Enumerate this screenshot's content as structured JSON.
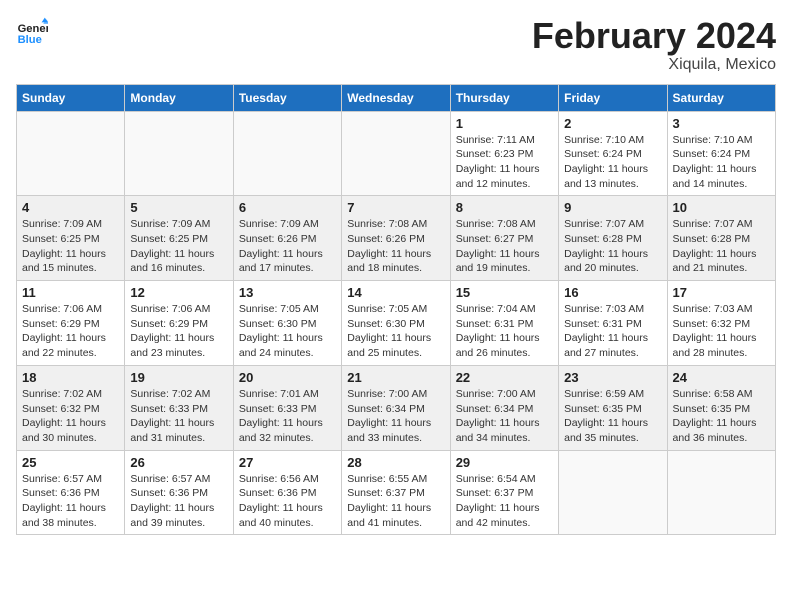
{
  "header": {
    "logo_line1": "General",
    "logo_line2": "Blue",
    "month": "February 2024",
    "location": "Xiquila, Mexico"
  },
  "weekdays": [
    "Sunday",
    "Monday",
    "Tuesday",
    "Wednesday",
    "Thursday",
    "Friday",
    "Saturday"
  ],
  "weeks": [
    [
      {
        "day": "",
        "info": "",
        "empty": true
      },
      {
        "day": "",
        "info": "",
        "empty": true
      },
      {
        "day": "",
        "info": "",
        "empty": true
      },
      {
        "day": "",
        "info": "",
        "empty": true
      },
      {
        "day": "1",
        "info": "Sunrise: 7:11 AM\nSunset: 6:23 PM\nDaylight: 11 hours\nand 12 minutes."
      },
      {
        "day": "2",
        "info": "Sunrise: 7:10 AM\nSunset: 6:24 PM\nDaylight: 11 hours\nand 13 minutes."
      },
      {
        "day": "3",
        "info": "Sunrise: 7:10 AM\nSunset: 6:24 PM\nDaylight: 11 hours\nand 14 minutes."
      }
    ],
    [
      {
        "day": "4",
        "info": "Sunrise: 7:09 AM\nSunset: 6:25 PM\nDaylight: 11 hours\nand 15 minutes."
      },
      {
        "day": "5",
        "info": "Sunrise: 7:09 AM\nSunset: 6:25 PM\nDaylight: 11 hours\nand 16 minutes."
      },
      {
        "day": "6",
        "info": "Sunrise: 7:09 AM\nSunset: 6:26 PM\nDaylight: 11 hours\nand 17 minutes."
      },
      {
        "day": "7",
        "info": "Sunrise: 7:08 AM\nSunset: 6:26 PM\nDaylight: 11 hours\nand 18 minutes."
      },
      {
        "day": "8",
        "info": "Sunrise: 7:08 AM\nSunset: 6:27 PM\nDaylight: 11 hours\nand 19 minutes."
      },
      {
        "day": "9",
        "info": "Sunrise: 7:07 AM\nSunset: 6:28 PM\nDaylight: 11 hours\nand 20 minutes."
      },
      {
        "day": "10",
        "info": "Sunrise: 7:07 AM\nSunset: 6:28 PM\nDaylight: 11 hours\nand 21 minutes."
      }
    ],
    [
      {
        "day": "11",
        "info": "Sunrise: 7:06 AM\nSunset: 6:29 PM\nDaylight: 11 hours\nand 22 minutes."
      },
      {
        "day": "12",
        "info": "Sunrise: 7:06 AM\nSunset: 6:29 PM\nDaylight: 11 hours\nand 23 minutes."
      },
      {
        "day": "13",
        "info": "Sunrise: 7:05 AM\nSunset: 6:30 PM\nDaylight: 11 hours\nand 24 minutes."
      },
      {
        "day": "14",
        "info": "Sunrise: 7:05 AM\nSunset: 6:30 PM\nDaylight: 11 hours\nand 25 minutes."
      },
      {
        "day": "15",
        "info": "Sunrise: 7:04 AM\nSunset: 6:31 PM\nDaylight: 11 hours\nand 26 minutes."
      },
      {
        "day": "16",
        "info": "Sunrise: 7:03 AM\nSunset: 6:31 PM\nDaylight: 11 hours\nand 27 minutes."
      },
      {
        "day": "17",
        "info": "Sunrise: 7:03 AM\nSunset: 6:32 PM\nDaylight: 11 hours\nand 28 minutes."
      }
    ],
    [
      {
        "day": "18",
        "info": "Sunrise: 7:02 AM\nSunset: 6:32 PM\nDaylight: 11 hours\nand 30 minutes."
      },
      {
        "day": "19",
        "info": "Sunrise: 7:02 AM\nSunset: 6:33 PM\nDaylight: 11 hours\nand 31 minutes."
      },
      {
        "day": "20",
        "info": "Sunrise: 7:01 AM\nSunset: 6:33 PM\nDaylight: 11 hours\nand 32 minutes."
      },
      {
        "day": "21",
        "info": "Sunrise: 7:00 AM\nSunset: 6:34 PM\nDaylight: 11 hours\nand 33 minutes."
      },
      {
        "day": "22",
        "info": "Sunrise: 7:00 AM\nSunset: 6:34 PM\nDaylight: 11 hours\nand 34 minutes."
      },
      {
        "day": "23",
        "info": "Sunrise: 6:59 AM\nSunset: 6:35 PM\nDaylight: 11 hours\nand 35 minutes."
      },
      {
        "day": "24",
        "info": "Sunrise: 6:58 AM\nSunset: 6:35 PM\nDaylight: 11 hours\nand 36 minutes."
      }
    ],
    [
      {
        "day": "25",
        "info": "Sunrise: 6:57 AM\nSunset: 6:36 PM\nDaylight: 11 hours\nand 38 minutes."
      },
      {
        "day": "26",
        "info": "Sunrise: 6:57 AM\nSunset: 6:36 PM\nDaylight: 11 hours\nand 39 minutes."
      },
      {
        "day": "27",
        "info": "Sunrise: 6:56 AM\nSunset: 6:36 PM\nDaylight: 11 hours\nand 40 minutes."
      },
      {
        "day": "28",
        "info": "Sunrise: 6:55 AM\nSunset: 6:37 PM\nDaylight: 11 hours\nand 41 minutes."
      },
      {
        "day": "29",
        "info": "Sunrise: 6:54 AM\nSunset: 6:37 PM\nDaylight: 11 hours\nand 42 minutes."
      },
      {
        "day": "",
        "info": "",
        "empty": true
      },
      {
        "day": "",
        "info": "",
        "empty": true
      }
    ]
  ]
}
